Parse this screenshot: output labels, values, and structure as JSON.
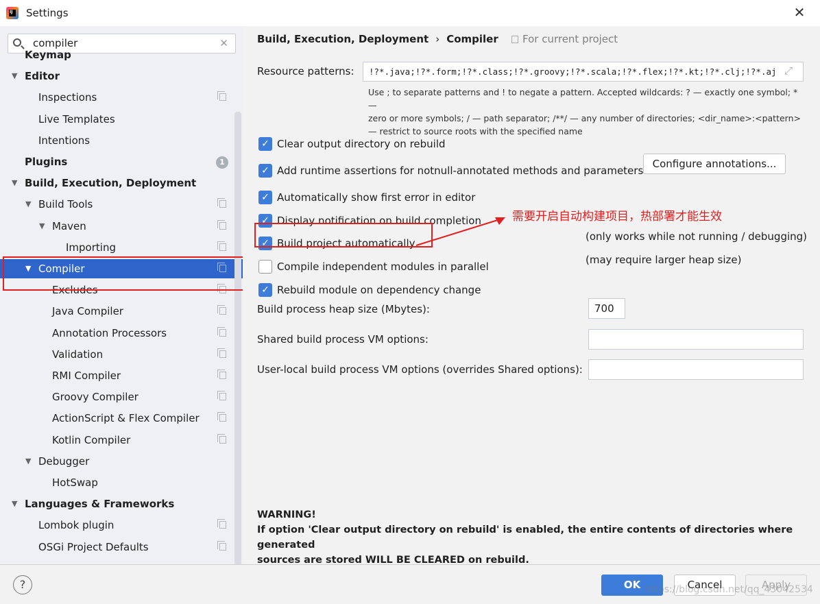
{
  "window": {
    "title": "Settings",
    "close": "✕"
  },
  "search": {
    "value": "compiler",
    "clear": "✕"
  },
  "tree": [
    {
      "label": "Keymap",
      "bold": true,
      "indent": 0,
      "tri": "",
      "copy": false
    },
    {
      "label": "Editor",
      "bold": true,
      "indent": 0,
      "tri": "▼",
      "copy": false
    },
    {
      "label": "Inspections",
      "bold": false,
      "indent": 1,
      "tri": "",
      "copy": true
    },
    {
      "label": "Live Templates",
      "bold": false,
      "indent": 1,
      "tri": "",
      "copy": false
    },
    {
      "label": "Intentions",
      "bold": false,
      "indent": 1,
      "tri": "",
      "copy": false
    },
    {
      "label": "Plugins",
      "bold": true,
      "indent": 0,
      "tri": "",
      "copy": false,
      "badge": "1"
    },
    {
      "label": "Build, Execution, Deployment",
      "bold": true,
      "indent": 0,
      "tri": "▼",
      "copy": false
    },
    {
      "label": "Build Tools",
      "bold": false,
      "indent": 1,
      "tri": "▼",
      "copy": true
    },
    {
      "label": "Maven",
      "bold": false,
      "indent": 2,
      "tri": "▼",
      "copy": true
    },
    {
      "label": "Importing",
      "bold": false,
      "indent": 3,
      "tri": "",
      "copy": true
    },
    {
      "label": "Compiler",
      "bold": false,
      "indent": 1,
      "tri": "▼",
      "copy": true,
      "selected": true
    },
    {
      "label": "Excludes",
      "bold": false,
      "indent": 2,
      "tri": "",
      "copy": true
    },
    {
      "label": "Java Compiler",
      "bold": false,
      "indent": 2,
      "tri": "",
      "copy": true
    },
    {
      "label": "Annotation Processors",
      "bold": false,
      "indent": 2,
      "tri": "",
      "copy": true
    },
    {
      "label": "Validation",
      "bold": false,
      "indent": 2,
      "tri": "",
      "copy": true
    },
    {
      "label": "RMI Compiler",
      "bold": false,
      "indent": 2,
      "tri": "",
      "copy": true
    },
    {
      "label": "Groovy Compiler",
      "bold": false,
      "indent": 2,
      "tri": "",
      "copy": true
    },
    {
      "label": "ActionScript & Flex Compiler",
      "bold": false,
      "indent": 2,
      "tri": "",
      "copy": true
    },
    {
      "label": "Kotlin Compiler",
      "bold": false,
      "indent": 2,
      "tri": "",
      "copy": true
    },
    {
      "label": "Debugger",
      "bold": false,
      "indent": 1,
      "tri": "▼",
      "copy": false
    },
    {
      "label": "HotSwap",
      "bold": false,
      "indent": 2,
      "tri": "",
      "copy": false
    },
    {
      "label": "Languages & Frameworks",
      "bold": true,
      "indent": 0,
      "tri": "▼",
      "copy": false
    },
    {
      "label": "Lombok plugin",
      "bold": false,
      "indent": 1,
      "tri": "",
      "copy": true
    },
    {
      "label": "OSGi Project Defaults",
      "bold": false,
      "indent": 1,
      "tri": "",
      "copy": true
    }
  ],
  "breadcrumb": {
    "parent": "Build, Execution, Deployment",
    "sep": "›",
    "current": "Compiler",
    "scope": "For current project"
  },
  "resource": {
    "label": "Resource patterns:",
    "value": "!?*.java;!?*.form;!?*.class;!?*.groovy;!?*.scala;!?*.flex;!?*.kt;!?*.clj;!?*.aj",
    "expand": "⤢",
    "hint1": "Use ; to separate patterns and ! to negate a pattern. Accepted wildcards: ? — exactly one symbol; * —",
    "hint2": "zero or more symbols; / — path separator; /**/ — any number of directories; <dir_name>:<pattern>",
    "hint3": "— restrict to source roots with the specified name"
  },
  "options": [
    {
      "label": "Clear output directory on rebuild",
      "checked": true
    },
    {
      "label": "Add runtime assertions for notnull-annotated methods and parameters",
      "checked": true
    },
    {
      "label": "Automatically show first error in editor",
      "checked": true
    },
    {
      "label": "Display notification on build completion",
      "checked": true
    },
    {
      "label": "Build project automatically",
      "checked": true
    },
    {
      "label": "Compile independent modules in parallel",
      "checked": false
    },
    {
      "label": "Rebuild module on dependency change",
      "checked": true
    }
  ],
  "configure_button": "Configure annotations...",
  "notes": {
    "build_auto": "(only works while not running / debugging)",
    "parallel": "(may require larger heap size)"
  },
  "annotation": "需要开启自动构建项目，热部署才能生效",
  "heap": {
    "label": "Build process heap size (Mbytes):",
    "value": "700"
  },
  "shared_vm": {
    "label": "Shared build process VM options:",
    "value": ""
  },
  "user_vm": {
    "label": "User-local build process VM options (overrides Shared options):",
    "value": ""
  },
  "warning": {
    "title": "WARNING!",
    "line1": "If option 'Clear output directory on rebuild' is enabled, the entire contents of directories where generated",
    "line2": "sources are stored WILL BE CLEARED on rebuild."
  },
  "buttons": {
    "help": "?",
    "ok": "OK",
    "cancel": "Cancel",
    "apply": "Apply"
  },
  "watermark": "https://blog.csdn.net/qq_43042534",
  "colors": {
    "accent": "#3d7dd9",
    "selection": "#2f65ca",
    "annotation": "#e02020"
  }
}
